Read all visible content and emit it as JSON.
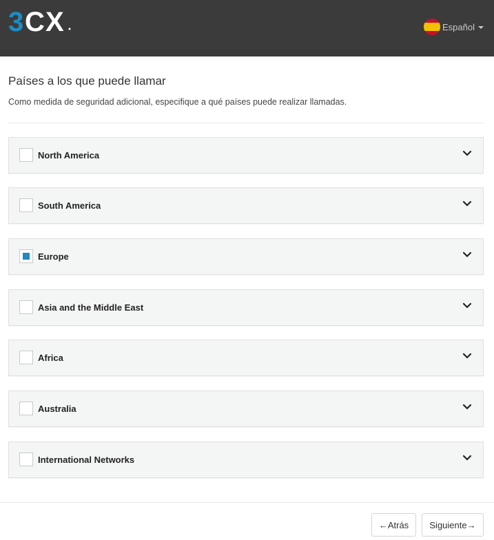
{
  "brand": {
    "logo_text": "3CX",
    "colors": {
      "topbar": "#3b3b3b",
      "logo_blue": "#1e8bc3",
      "checkbox_checked": "#1e8bc3"
    }
  },
  "header": {
    "language_label": "Español",
    "language_flag": "spain-flag-icon"
  },
  "page": {
    "title": "Países a los que puede llamar",
    "subtitle": "Como medida de seguridad adicional, especifique a qué países puede realizar llamadas."
  },
  "regions": [
    {
      "label": "North America",
      "checked": false
    },
    {
      "label": "South America",
      "checked": false
    },
    {
      "label": "Europe",
      "checked": true
    },
    {
      "label": "Asia and the Middle East",
      "checked": false
    },
    {
      "label": "Africa",
      "checked": false
    },
    {
      "label": "Australia",
      "checked": false
    },
    {
      "label": "International Networks",
      "checked": false
    }
  ],
  "footer": {
    "back_label": "←Atrás",
    "next_label": "Siguiente→"
  }
}
